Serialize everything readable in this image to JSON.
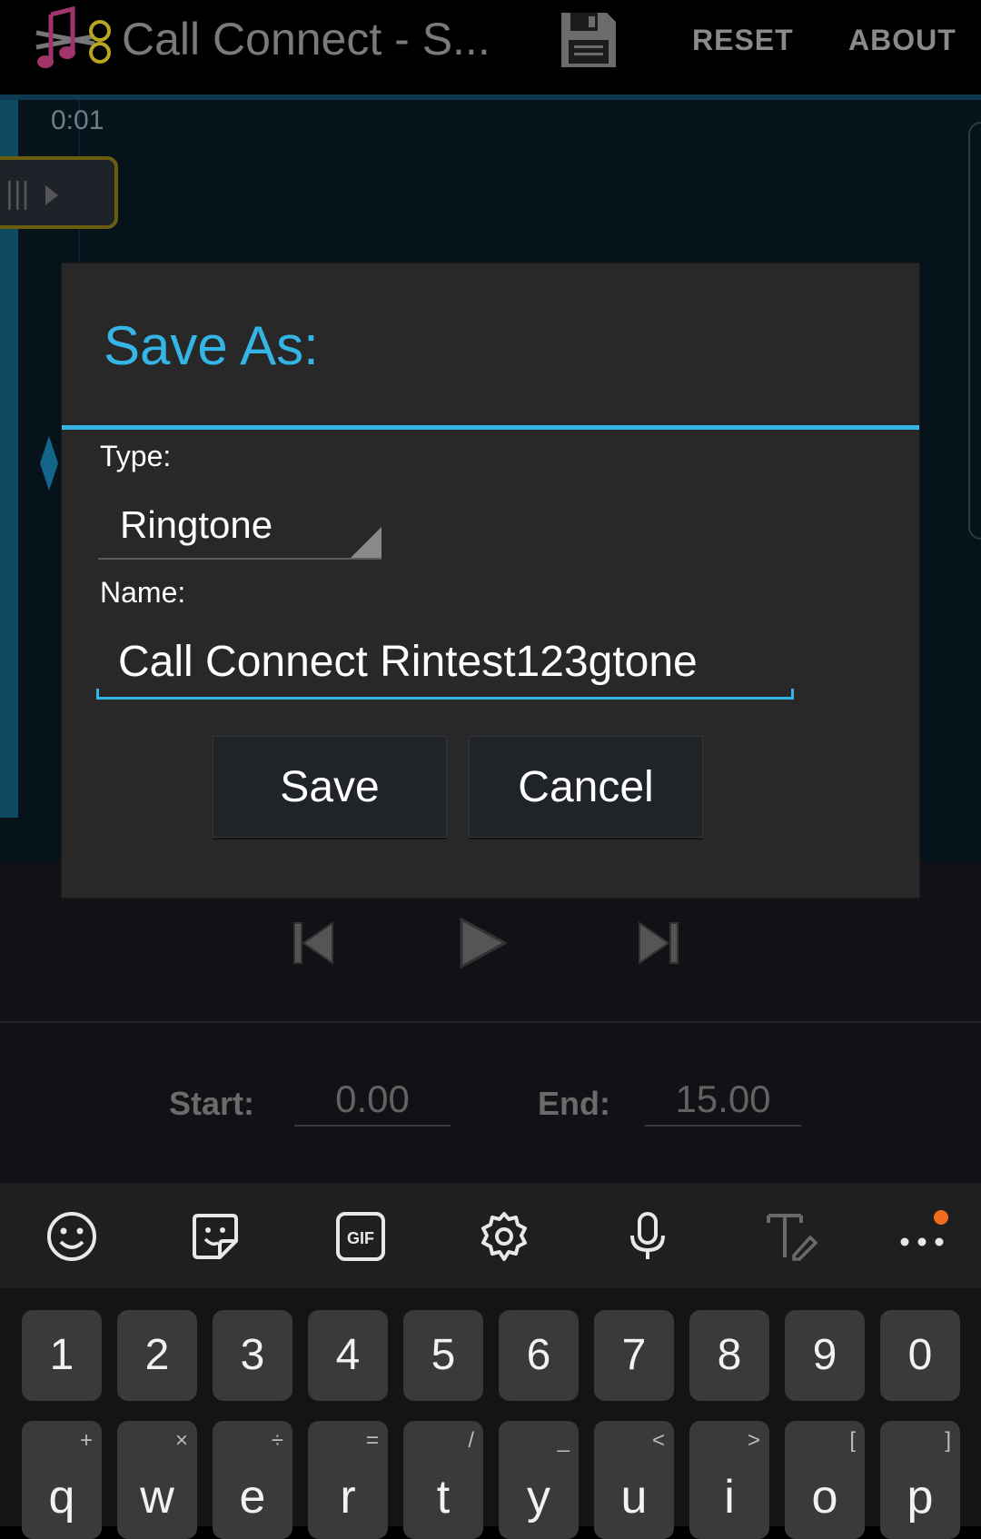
{
  "appbar": {
    "title": "Call Connect - S...",
    "reset_label": "RESET",
    "about_label": "ABOUT"
  },
  "waveform": {
    "time_label": "0:01"
  },
  "dialog": {
    "title": "Save As:",
    "type_label": "Type:",
    "type_value": "Ringtone",
    "name_label": "Name:",
    "name_value": "Call Connect Rintest123gtone",
    "save_label": "Save",
    "cancel_label": "Cancel"
  },
  "range": {
    "start_label": "Start:",
    "start_value": "0.00",
    "end_label": "End:",
    "end_value": "15.00"
  },
  "keyboard": {
    "toolbar_icons": [
      "emoji-icon",
      "sticker-icon",
      "gif-icon",
      "settings-icon",
      "microphone-icon",
      "handwriting-icon",
      "more-icon"
    ],
    "number_row": [
      "1",
      "2",
      "3",
      "4",
      "5",
      "6",
      "7",
      "8",
      "9",
      "0"
    ],
    "letter_row": [
      {
        "key": "q",
        "alt": "+"
      },
      {
        "key": "w",
        "alt": "×"
      },
      {
        "key": "e",
        "alt": "÷"
      },
      {
        "key": "r",
        "alt": "="
      },
      {
        "key": "t",
        "alt": "/"
      },
      {
        "key": "y",
        "alt": "_"
      },
      {
        "key": "u",
        "alt": "<"
      },
      {
        "key": "i",
        "alt": ">"
      },
      {
        "key": "o",
        "alt": "["
      },
      {
        "key": "p",
        "alt": "]"
      }
    ]
  },
  "colors": {
    "accent": "#33b5e5",
    "dialog_bg": "#282828",
    "notification_dot": "#f26b1d"
  }
}
